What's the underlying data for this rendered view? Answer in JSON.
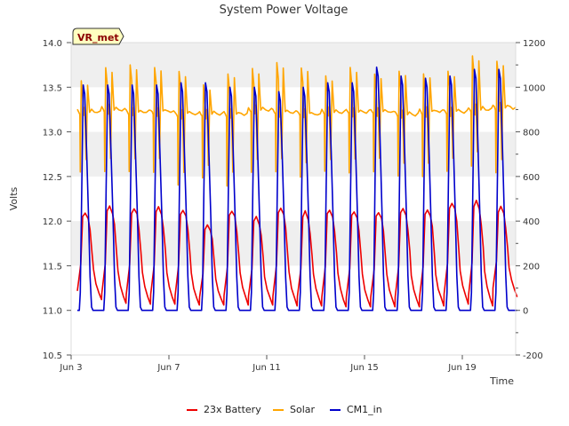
{
  "chart_data": {
    "type": "line",
    "title": "System Power Voltage",
    "xlabel": "Time",
    "ylabel": "Volts",
    "x_start": "2023-06-03",
    "x_end": "2023-06-20",
    "xticks": [
      {
        "date": "2023-06-03",
        "label": "Jun 3"
      },
      {
        "date": "2023-06-07",
        "label": "Jun 7"
      },
      {
        "date": "2023-06-11",
        "label": "Jun 11"
      },
      {
        "date": "2023-06-15",
        "label": "Jun 15"
      },
      {
        "date": "2023-06-19",
        "label": "Jun 19"
      }
    ],
    "ylim": [
      10.5,
      14.0
    ],
    "yticks": [
      "10.5",
      "11.0",
      "11.5",
      "12.0",
      "12.5",
      "13.0",
      "13.5",
      "14.0"
    ],
    "y2lim": [
      -200,
      1200
    ],
    "y2ticks": [
      "-200",
      "0",
      "200",
      "400",
      "600",
      "800",
      "1000",
      "1200"
    ],
    "grid": "horizontal bands",
    "legend_position": "bottom",
    "badge": "VR_met",
    "colors": {
      "band": "#efefef",
      "battery": "#ee0000",
      "solar": "#ffa500",
      "cm1": "#0000cc",
      "badge_bg": "#ffffc0"
    },
    "days": [
      "Jun 3",
      "Jun 4",
      "Jun 5",
      "Jun 6",
      "Jun 7",
      "Jun 8",
      "Jun 9",
      "Jun 10",
      "Jun 11",
      "Jun 12",
      "Jun 13",
      "Jun 14",
      "Jun 15",
      "Jun 16",
      "Jun 17",
      "Jun 18",
      "Jun 19",
      "Jun 20"
    ],
    "series": [
      {
        "name": "23x Battery",
        "axis": "left",
        "color": "#ee0000",
        "night_min": [
          11.12,
          11.08,
          11.07,
          11.07,
          11.06,
          11.06,
          11.06,
          11.06,
          11.05,
          11.05,
          11.04,
          11.04,
          11.04,
          11.04,
          11.05,
          11.07,
          11.05,
          11.15
        ],
        "day_peak": [
          12.1,
          12.17,
          12.14,
          12.16,
          12.13,
          11.95,
          12.12,
          12.05,
          12.15,
          12.1,
          12.14,
          12.12,
          12.11,
          12.15,
          12.13,
          12.2,
          12.22,
          12.15
        ]
      },
      {
        "name": "Solar",
        "axis": "right",
        "color": "#ffa500",
        "night_level": [
          890,
          900,
          890,
          890,
          880,
          880,
          880,
          900,
          890,
          880,
          890,
          890,
          890,
          880,
          890,
          890,
          900,
          910
        ],
        "day_peak": [
          1030,
          1090,
          1100,
          1090,
          1070,
          1010,
          1060,
          1080,
          1110,
          1090,
          1050,
          1090,
          1060,
          1070,
          1060,
          1070,
          1140,
          1120
        ],
        "day_trough": [
          620,
          620,
          620,
          620,
          560,
          590,
          560,
          620,
          620,
          600,
          620,
          620,
          620,
          600,
          600,
          620,
          650,
          620
        ]
      },
      {
        "name": "CM1_in",
        "axis": "right",
        "color": "#0000cc",
        "night_level": [
          0,
          0,
          0,
          0,
          0,
          0,
          0,
          0,
          0,
          0,
          0,
          0,
          0,
          0,
          0,
          0,
          0,
          0
        ],
        "day_peak": [
          1010,
          1010,
          1010,
          1010,
          1020,
          1020,
          1000,
          1000,
          980,
          1000,
          1020,
          1020,
          1090,
          1050,
          1040,
          1050,
          1080,
          1080
        ]
      }
    ]
  }
}
